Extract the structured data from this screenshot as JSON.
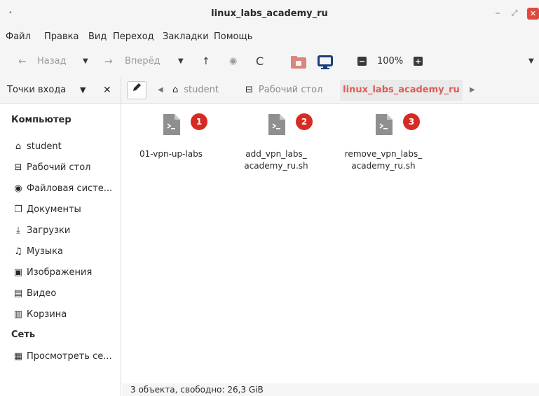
{
  "window": {
    "title": "linux_labs_academy_ru",
    "menu_dot": "•",
    "minimize": "–",
    "maximize": "⤢",
    "close": "✕"
  },
  "menubar": [
    "Файл",
    "Правка",
    "Вид",
    "Переход",
    "Закладки",
    "Помощь"
  ],
  "toolbar": {
    "back_label": "Назад",
    "forward_label": "Вперёд",
    "zoom": "100%",
    "zoom_out": "−",
    "zoom_in": "+"
  },
  "location": {
    "places_label": "Точки входа",
    "breadcrumbs": [
      "student",
      "Рабочий стол",
      "linux_labs_academy_ru"
    ]
  },
  "sidebar": {
    "computer_heading": "Компьютер",
    "computer_items": [
      {
        "label": "student",
        "icon": "home-icon"
      },
      {
        "label": "Рабочий стол",
        "icon": "desktop-icon"
      },
      {
        "label": "Файловая систе...",
        "icon": "filesystem-icon"
      },
      {
        "label": "Документы",
        "icon": "documents-icon"
      },
      {
        "label": "Загрузки",
        "icon": "downloads-icon"
      },
      {
        "label": "Музыка",
        "icon": "music-icon"
      },
      {
        "label": "Изображения",
        "icon": "images-icon"
      },
      {
        "label": "Видео",
        "icon": "video-icon"
      },
      {
        "label": "Корзина",
        "icon": "trash-icon"
      }
    ],
    "network_heading": "Сеть",
    "network_items": [
      {
        "label": "Просмотреть се...",
        "icon": "network-icon"
      }
    ]
  },
  "files": [
    {
      "name_lines": [
        "01-vpn-up-labs"
      ],
      "badge": "1"
    },
    {
      "name_lines": [
        "add_vpn_labs_",
        "academy_ru.sh"
      ],
      "badge": "2"
    },
    {
      "name_lines": [
        "remove_vpn_labs_",
        "academy_ru.sh"
      ],
      "badge": "3"
    }
  ],
  "status": "3 объекта, свободно: 26,3 GiB",
  "colors": {
    "accent": "#e05a55",
    "badge": "#d62a22",
    "close": "#e04a3c"
  }
}
